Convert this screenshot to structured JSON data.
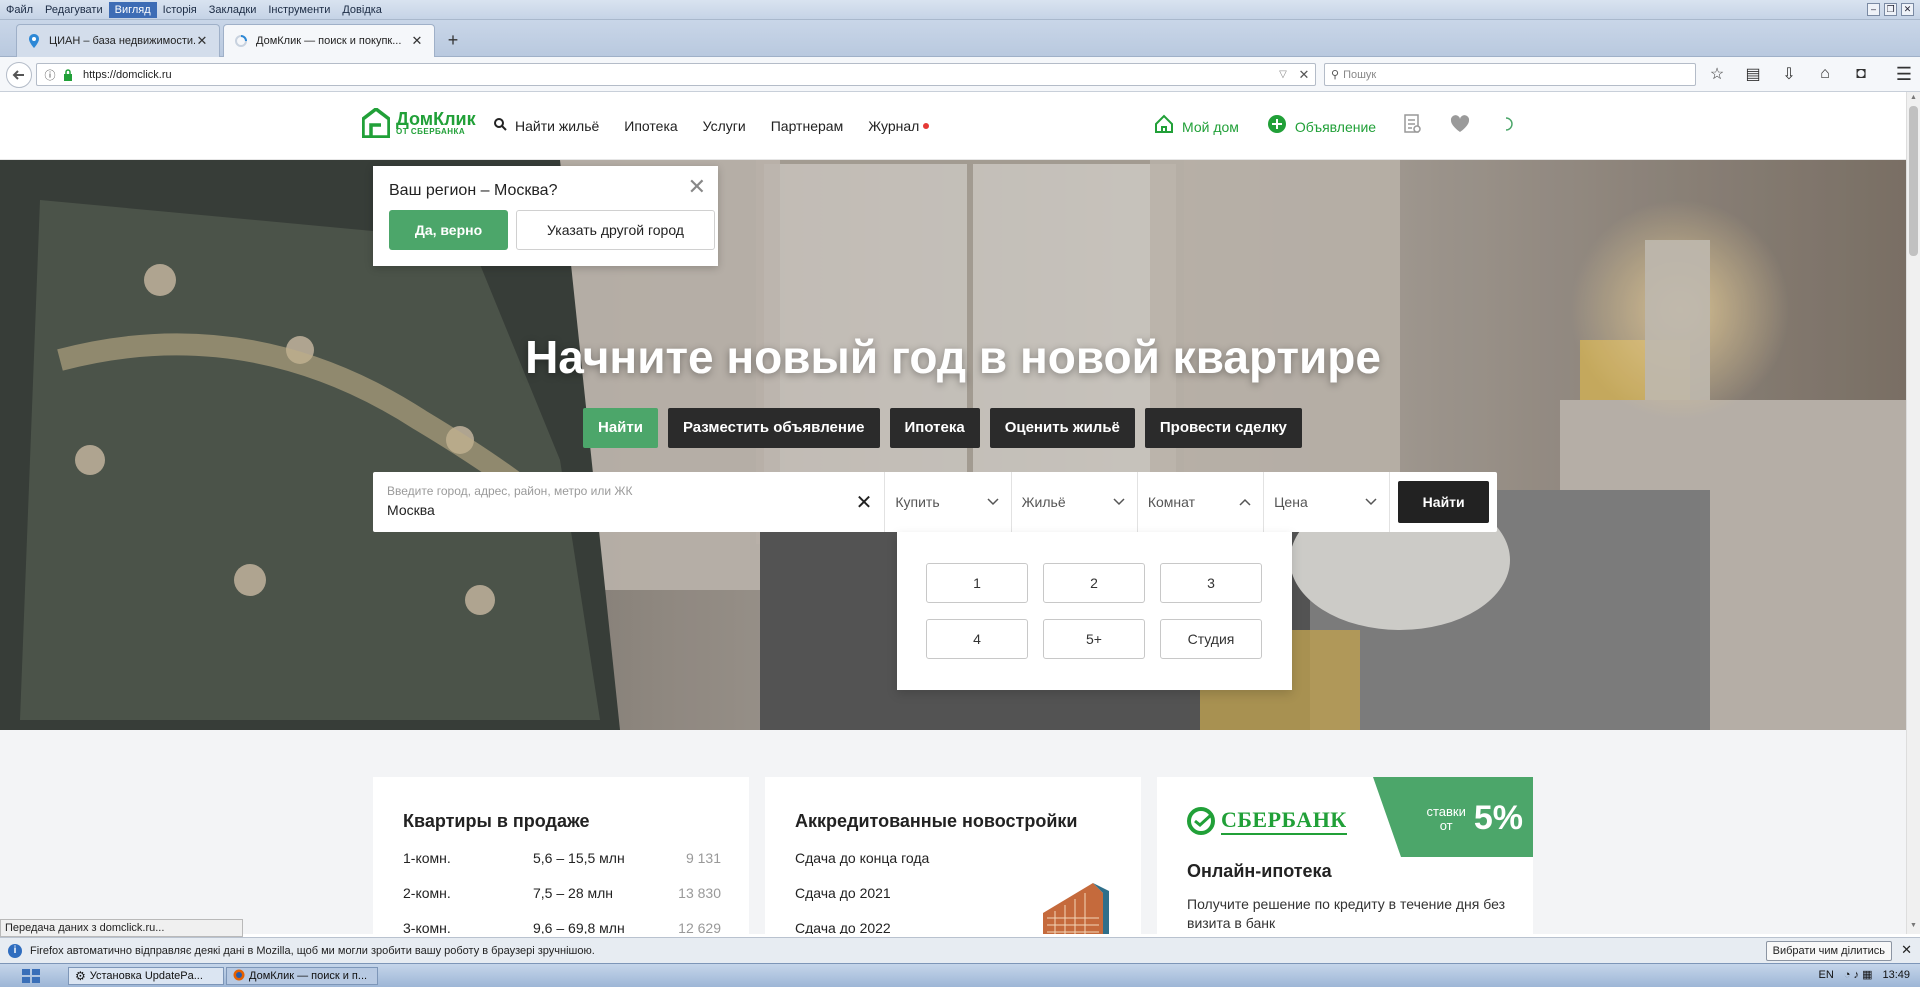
{
  "menubar": {
    "items": [
      "Файл",
      "Редагувати",
      "Вигляд",
      "Історія",
      "Закладки",
      "Інструменти",
      "Довідка"
    ],
    "active_index": 2
  },
  "tabs": [
    {
      "title": "ЦИАН – база недвижимости...",
      "icon": "map-pin-icon",
      "active": false
    },
    {
      "title": "ДомКлик — поиск и покупк...",
      "icon": "loading-spinner-icon",
      "active": true
    }
  ],
  "navbar": {
    "url": "https://domclick.ru",
    "search_placeholder": "Пошук"
  },
  "site": {
    "logo_brand": "ДомКлик",
    "logo_sub": "ОТ СБЕРБАНКА",
    "nav": [
      "Найти жильё",
      "Ипотека",
      "Услуги",
      "Партнерам",
      "Журнал"
    ],
    "my_home": "Мой дом",
    "ad": "Объявление"
  },
  "region_popup": {
    "question": "Ваш регион – Москва?",
    "yes": "Да, верно",
    "other": "Указать другой город"
  },
  "hero": {
    "headline": "Начните новый год в новой квартире",
    "tabs": [
      "Найти",
      "Разместить объявление",
      "Ипотека",
      "Оценить жильё",
      "Провести сделку"
    ],
    "active_tab_index": 0
  },
  "search": {
    "placeholder": "Введите город, адрес, район, метро или ЖК",
    "value": "Москва",
    "deal": "Купить",
    "type": "Жильё",
    "rooms": "Комнат",
    "price": "Цена",
    "submit": "Найти"
  },
  "rooms_options": [
    "1",
    "2",
    "3",
    "4",
    "5+",
    "Студия"
  ],
  "card_sale": {
    "title": "Квартиры в продаже",
    "rows": [
      {
        "rooms": "1-комн.",
        "price": "5,6 – 15,5 млн",
        "count": "9 131"
      },
      {
        "rooms": "2-комн.",
        "price": "7,5 – 28 млн",
        "count": "13 830"
      },
      {
        "rooms": "3-комн.",
        "price": "9,6 – 69,8 млн",
        "count": "12 629"
      }
    ]
  },
  "card_new": {
    "title": "Аккредитованные новостройки",
    "items": [
      "Сдача до конца года",
      "Сдача до 2021",
      "Сдача до 2022"
    ]
  },
  "card_sber": {
    "logo": "СБЕРБАНК",
    "rate_prefix_line1": "ставки",
    "rate_prefix_line2": "от",
    "rate_value": "5%",
    "title": "Онлайн-ипотека",
    "desc": "Получите решение по кредиту в течение дня без визита в банк"
  },
  "status_text": "Передача даних з domclick.ru...",
  "notification": {
    "text": "Firefox автоматично відправляє деякі дані в Mozilla, щоб ми могли зробити вашу роботу в браузері зручнішою.",
    "button": "Вибрати чим ділитись"
  },
  "taskbar": {
    "tasks": [
      "Установка UpdatePa...",
      "ДомКлик — поиск и п..."
    ],
    "lang": "EN",
    "time": "13:49"
  },
  "colors": {
    "brand_green": "#21a038",
    "button_green": "#4ca66a",
    "dark_button": "#2b2b2b"
  }
}
